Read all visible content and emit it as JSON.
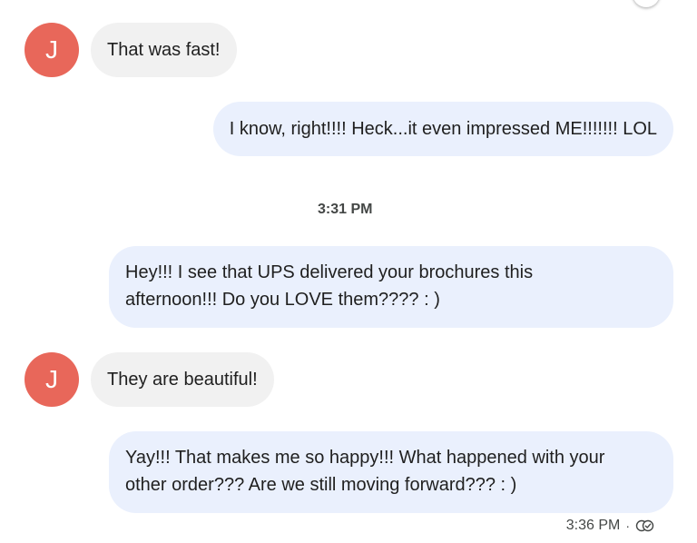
{
  "colors": {
    "avatar_bg": "#e8675a",
    "outgoing_bubble": "#eaf0fd",
    "incoming_bubble": "#f1f1f1"
  },
  "contact": {
    "initial": "J"
  },
  "messages": [
    {
      "direction": "incoming",
      "text": "That was fast!"
    },
    {
      "direction": "outgoing",
      "text": "I know, right!!!! Heck...it even impressed ME!!!!!!! LOL"
    },
    {
      "direction": "outgoing",
      "text_lines": [
        "Hey!!! I see that UPS delivered your brochures this",
        "afternoon!!! Do you LOVE them???? : )"
      ]
    },
    {
      "direction": "incoming",
      "text": "They are beautiful!"
    },
    {
      "direction": "outgoing",
      "text_lines": [
        "Yay!!! That makes me so happy!!! What happened with your",
        "other order??? Are we still moving forward??? : )"
      ]
    }
  ],
  "timestamps": {
    "divider": "3:31 PM",
    "last_message": "3:36 PM",
    "separator": "·"
  },
  "icons": {
    "read_receipt": "read-receipt-icon"
  }
}
